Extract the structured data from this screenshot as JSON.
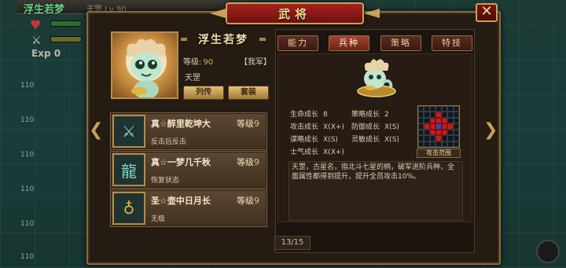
{
  "background": {
    "player_name": "浮生若梦",
    "player_meta": "天罡 Lv 90",
    "exp_label": "Exp 0",
    "map_numbers": [
      "110",
      "110",
      "110",
      "110",
      "110",
      "110"
    ]
  },
  "dialog": {
    "title": "武将",
    "close_label": "✕"
  },
  "hero": {
    "name": "浮生若梦",
    "level_label": "等级:",
    "level_value": "90",
    "faction": "【我军】",
    "title": "天罡",
    "bio_button": "列传",
    "equip_button": "套装"
  },
  "skills": [
    {
      "name": "真☆醉里乾坤大",
      "level_label": "等级",
      "level": "9",
      "desc": "反击后反击",
      "icon": "sword-axe-icon"
    },
    {
      "name": "真☆一梦几千秋",
      "level_label": "等级",
      "level": "9",
      "desc": "恢复状态",
      "icon": "dragon-icon"
    },
    {
      "name": "圣☆壶中日月长",
      "level_label": "等级",
      "level": "9",
      "desc": "无极",
      "icon": "gourd-icon"
    }
  ],
  "tabs": [
    {
      "label": "能力",
      "active": false
    },
    {
      "label": "兵种",
      "active": true
    },
    {
      "label": "策略",
      "active": false
    },
    {
      "label": "特技",
      "active": false
    }
  ],
  "unit": {
    "stats": [
      {
        "label": "生命成长",
        "value": "8"
      },
      {
        "label": "策略成长",
        "value": "2"
      },
      {
        "label": "攻击成长",
        "value": "X(X+)"
      },
      {
        "label": "防御成长",
        "value": "X(S)"
      },
      {
        "label": "谋略成长",
        "value": "X(S)"
      },
      {
        "label": "灵敏成长",
        "value": "X(S)"
      },
      {
        "label": "士气成长",
        "value": "X(X+)"
      }
    ],
    "range_label": "攻击范围",
    "description": "天罡，古星名，指北斗七星的柄，破军进阶兵种，全面属性都得到提升，提升全员攻击10%。"
  },
  "pagination": {
    "text": "13/15"
  },
  "colors": {
    "title_red": "#a4221b",
    "gold_border": "#c9a15a",
    "range_red": "#c81e1e",
    "range_center": "#2a4fd0"
  }
}
